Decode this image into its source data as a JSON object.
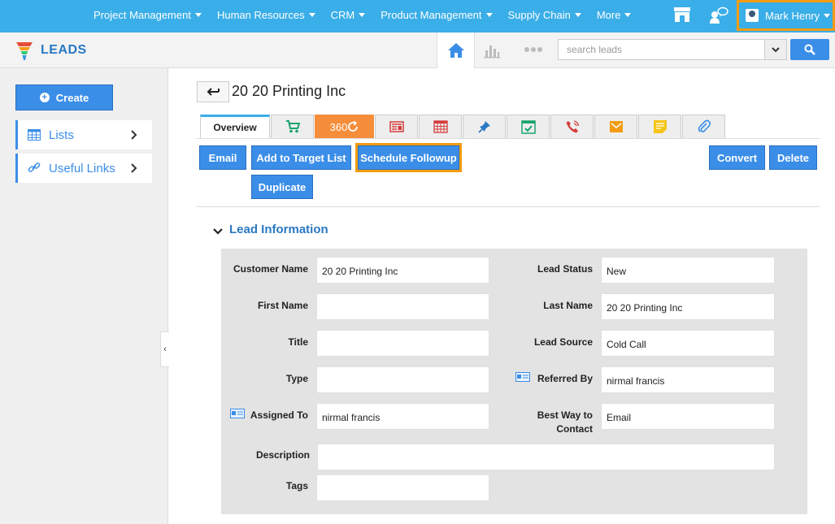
{
  "topnav": {
    "menu": [
      {
        "label": "Project Management"
      },
      {
        "label": "Human Resources"
      },
      {
        "label": "CRM"
      },
      {
        "label": "Product Management"
      },
      {
        "label": "Supply Chain"
      },
      {
        "label": "More"
      }
    ],
    "user_name": "Mark Henry"
  },
  "app": {
    "title": "LEADS",
    "search_placeholder": "search leads"
  },
  "sidebar": {
    "create_label": "Create",
    "items": [
      {
        "label": "Lists",
        "icon": "table-icon"
      },
      {
        "label": "Useful Links",
        "icon": "link-icon"
      }
    ]
  },
  "record": {
    "title": "20 20 Printing Inc"
  },
  "tabs": {
    "overview": "Overview",
    "t360": "360"
  },
  "actions": {
    "email": "Email",
    "add_to_target": "Add to Target List",
    "schedule_followup": "Schedule Followup",
    "duplicate": "Duplicate",
    "convert": "Convert",
    "delete": "Delete"
  },
  "section": {
    "title": "Lead Information"
  },
  "fields": {
    "customer_name": {
      "label": "Customer Name",
      "value": "20 20 Printing Inc"
    },
    "lead_status": {
      "label": "Lead Status",
      "value": "New"
    },
    "first_name": {
      "label": "First Name",
      "value": ""
    },
    "last_name": {
      "label": "Last Name",
      "value": "20 20 Printing Inc"
    },
    "title": {
      "label": "Title",
      "value": ""
    },
    "lead_source": {
      "label": "Lead Source",
      "value": "Cold Call"
    },
    "type": {
      "label": "Type",
      "value": ""
    },
    "referred_by": {
      "label": "Referred By",
      "value": "nirmal francis"
    },
    "assigned_to": {
      "label": "Assigned To",
      "value": "nirmal francis"
    },
    "best_way_line1": "Best Way to",
    "best_way_line2": "Contact",
    "best_way_value": "Email",
    "description": {
      "label": "Description",
      "value": ""
    },
    "tags": {
      "label": "Tags",
      "value": ""
    }
  },
  "colors": {
    "topbar": "#3aaee8",
    "accent": "#3b8ee8",
    "highlight": "#f39c12",
    "tab360": "#f58d3a"
  }
}
